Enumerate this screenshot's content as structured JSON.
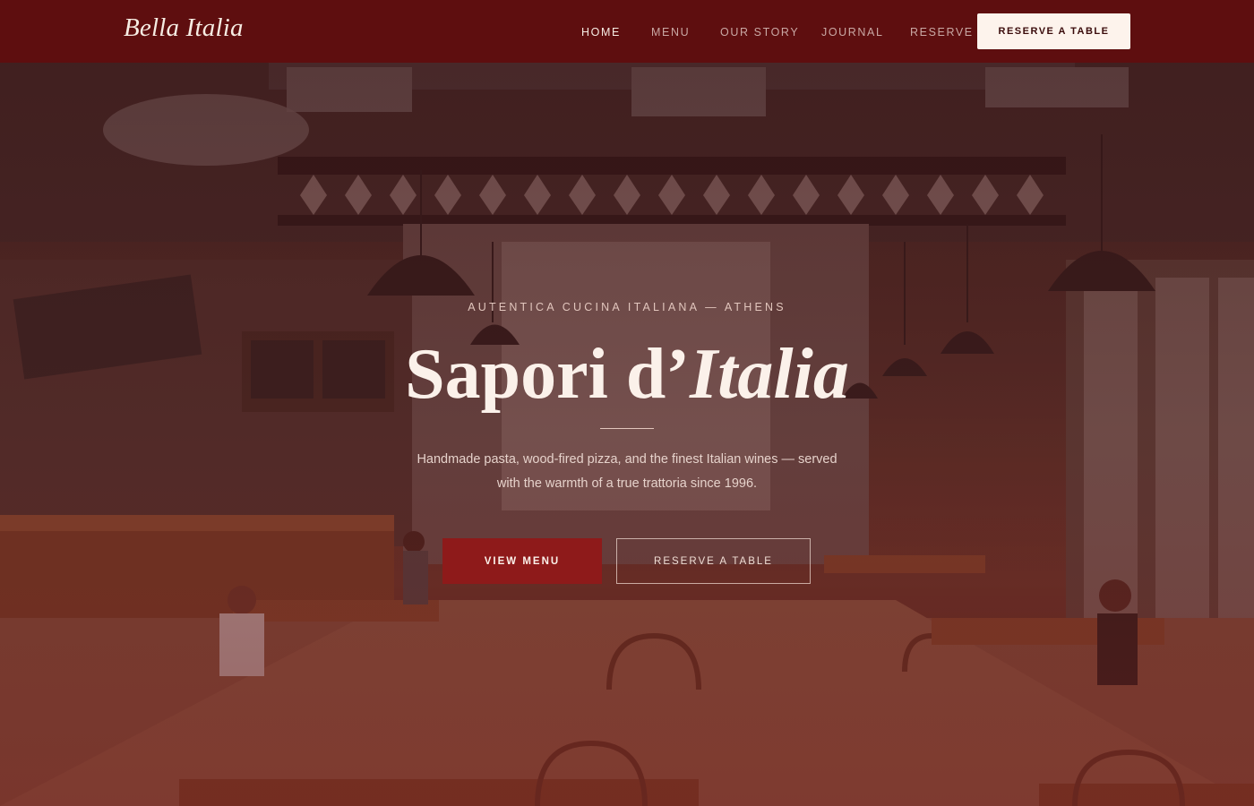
{
  "header": {
    "brand": "Bella Italia",
    "nav": [
      {
        "label": "HOME",
        "active": true
      },
      {
        "label": "MENU",
        "active": false
      },
      {
        "label": "OUR STORY",
        "active": false
      },
      {
        "label": "JOURNAL",
        "active": false
      },
      {
        "label": "RESERVE",
        "active": false
      }
    ],
    "cta_label": "RESERVE A TABLE"
  },
  "hero": {
    "eyebrow": "AUTENTICA CUCINA ITALIANA — ATHENS",
    "headline_plain": "Sapori d’",
    "headline_italic": "Italia",
    "subtitle": "Handmade pasta, wood-fired pizza, and the finest Italian wines — served with the warmth of a true trattoria since 1996.",
    "primary_button": "VIEW MENU",
    "secondary_button": "RESERVE A TABLE"
  },
  "colors": {
    "nav_background": "#5e0e0f",
    "accent": "#8e1a1a",
    "cream": "#fbf1ea"
  }
}
